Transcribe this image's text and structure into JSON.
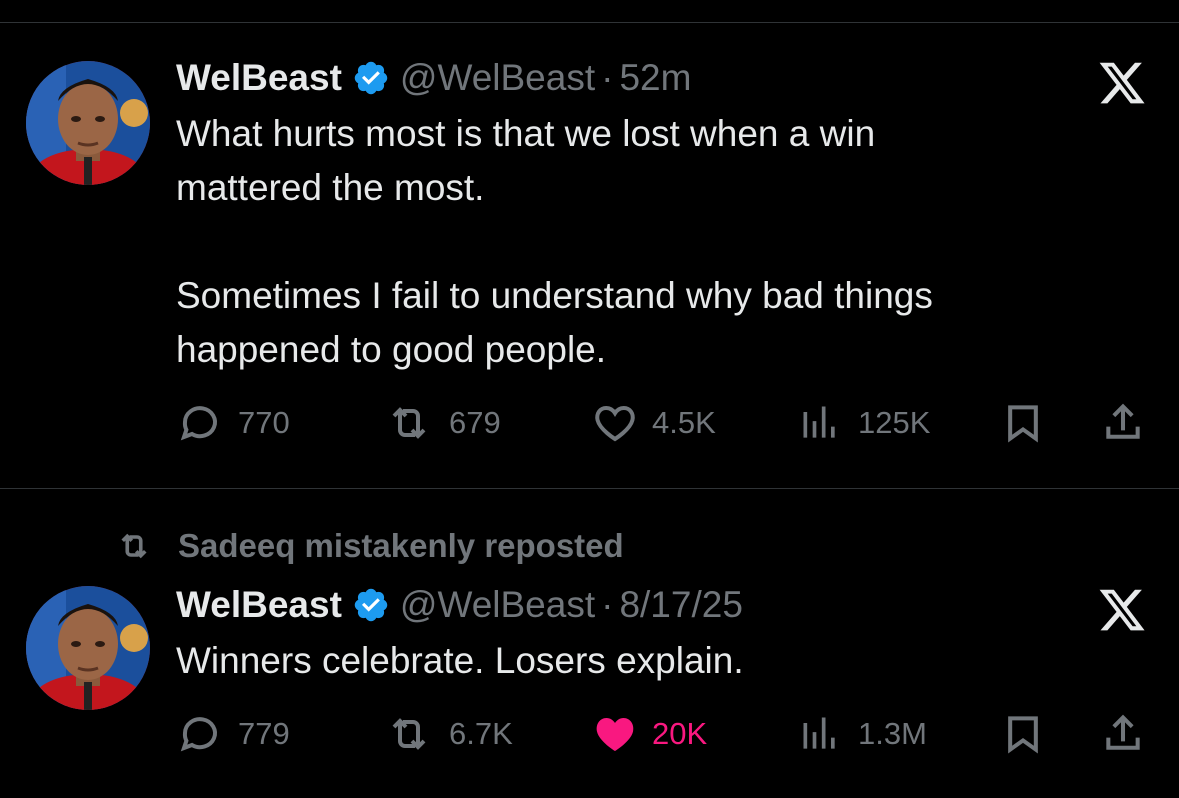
{
  "colors": {
    "background": "#000000",
    "text": "#e7e9ea",
    "muted": "#71767b",
    "verified": "#1d9bf0",
    "like_active": "#f91880",
    "divider": "#2f3336"
  },
  "tweets": [
    {
      "author_name": "WelBeast",
      "handle": "@WelBeast",
      "separator": "·",
      "time": "52m",
      "text": "What hurts most is that we lost when a win\nmattered the most.\n\nSometimes I fail to understand why bad things\nhappened to good people.",
      "replies": "770",
      "reposts": "679",
      "likes": "4.5K",
      "views": "125K",
      "liked": false,
      "icons": [
        "verified-badge-icon",
        "x-logo-icon",
        "reply-icon",
        "repost-icon",
        "like-icon",
        "views-icon",
        "bookmark-icon",
        "share-icon"
      ]
    },
    {
      "repost_context": "Sadeeq mistakenly reposted",
      "author_name": "WelBeast",
      "handle": "@WelBeast",
      "separator": "·",
      "time": "8/17/25",
      "text": "Winners celebrate. Losers explain.",
      "replies": "779",
      "reposts": "6.7K",
      "likes": "20K",
      "views": "1.3M",
      "liked": true,
      "icons": [
        "repost-icon",
        "verified-badge-icon",
        "x-logo-icon",
        "reply-icon",
        "repost-icon",
        "like-filled-icon",
        "views-icon",
        "bookmark-icon",
        "share-icon"
      ]
    }
  ]
}
